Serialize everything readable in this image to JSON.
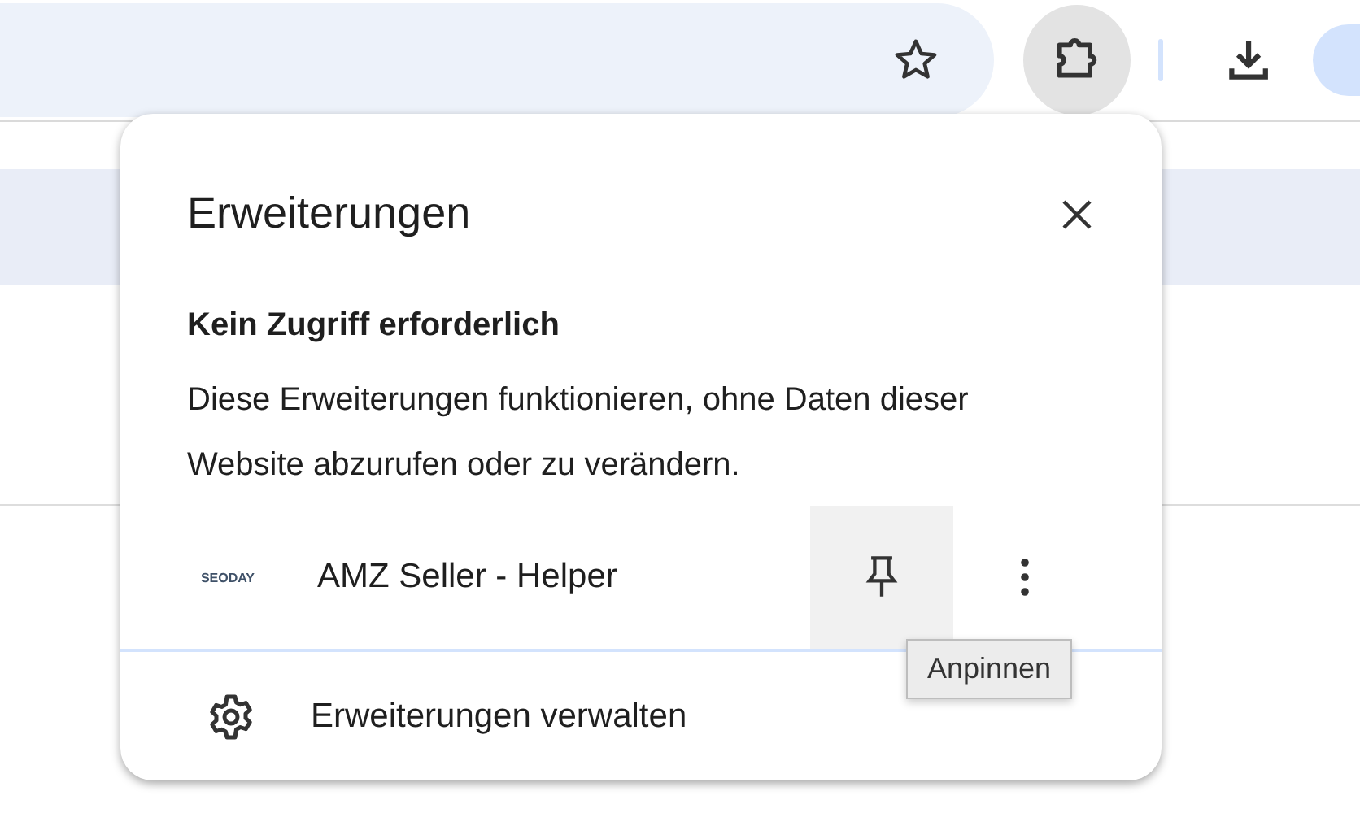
{
  "toolbar": {
    "extensions_button": {
      "active": true
    }
  },
  "popup": {
    "title": "Erweiterungen",
    "section_heading": "Kein Zugriff erforderlich",
    "description": "Diese Erweiterungen funktionieren, ohne Daten dieser Website abzurufen oder zu verändern.",
    "extensions": [
      {
        "name": "AMZ Seller - Helper",
        "logo_text": "SEODAY",
        "pin_hovered": true
      }
    ],
    "tooltip": "Anpinnen",
    "manage": "Erweiterungen verwalten"
  }
}
